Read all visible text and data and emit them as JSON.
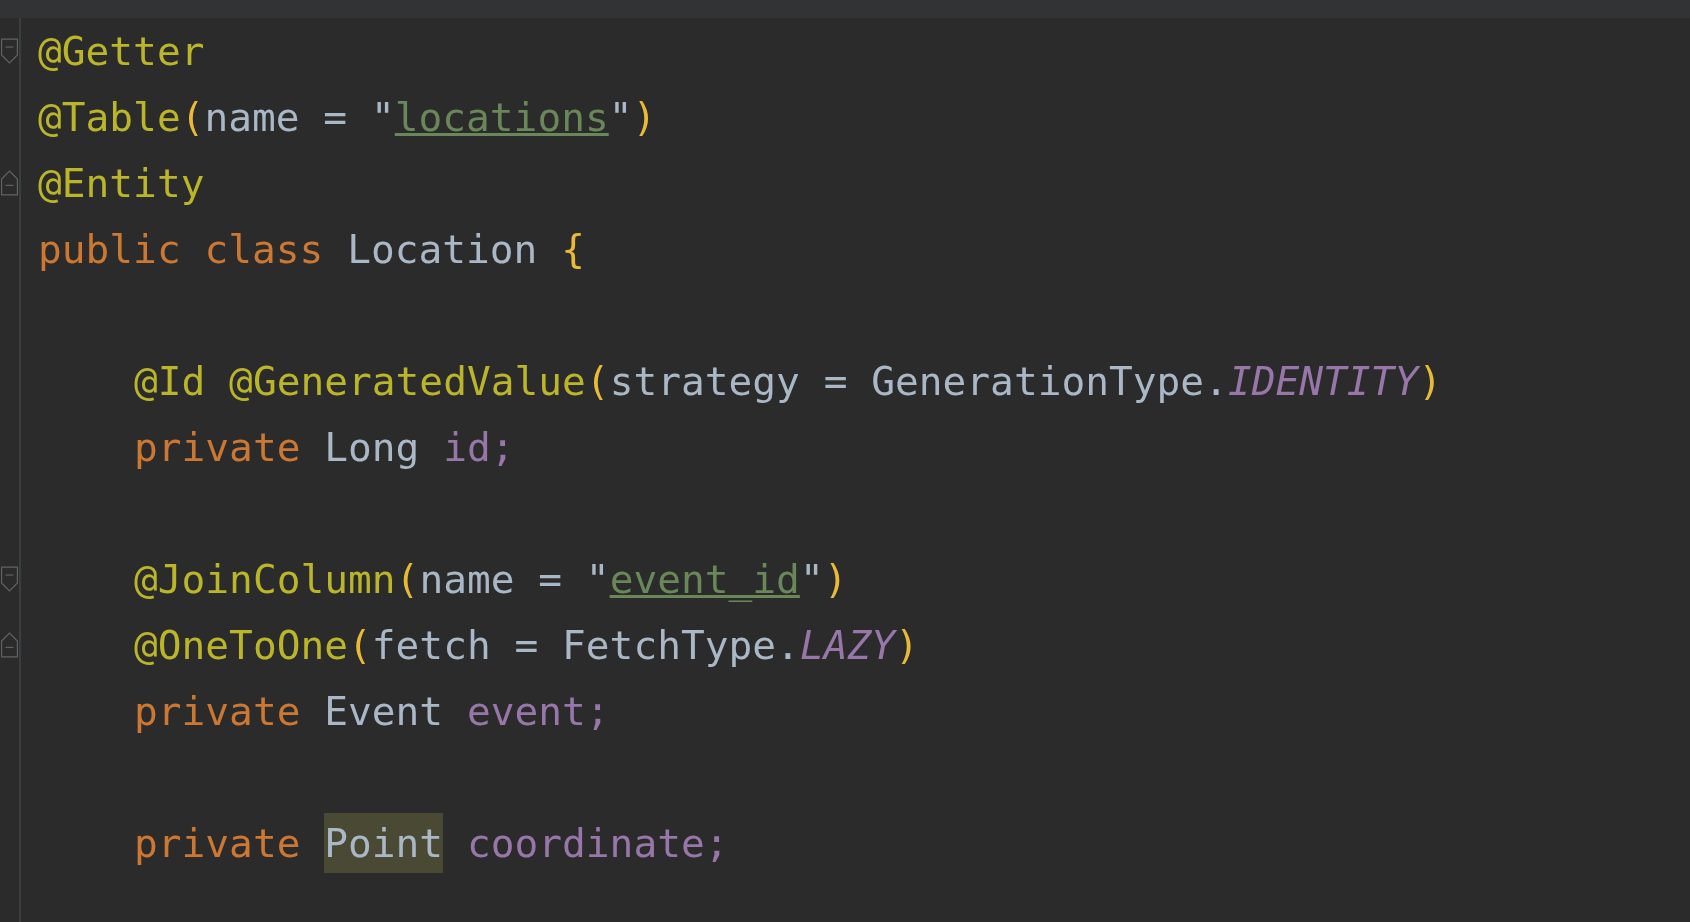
{
  "editor": {
    "lines": [
      {
        "kind": "code",
        "fold_start": true,
        "fold_end": false,
        "indented": false,
        "tokens": [
          {
            "text": "@Getter",
            "kind": "annotation"
          }
        ]
      },
      {
        "kind": "code",
        "fold_start": false,
        "fold_end": false,
        "indented": false,
        "tokens": [
          {
            "text": "@Table",
            "kind": "annotation"
          },
          {
            "text": "(",
            "kind": "bracket"
          },
          {
            "text": "name = \"",
            "kind": "plain"
          },
          {
            "text": "locations",
            "kind": "link"
          },
          {
            "text": "\"",
            "kind": "plain"
          },
          {
            "text": ")",
            "kind": "bracket"
          }
        ]
      },
      {
        "kind": "code",
        "fold_start": false,
        "fold_end": true,
        "indented": false,
        "tokens": [
          {
            "text": "@Entity",
            "kind": "annotation"
          }
        ]
      },
      {
        "kind": "code",
        "fold_start": false,
        "fold_end": false,
        "indented": false,
        "tokens": [
          {
            "text": "public class ",
            "kind": "keyword"
          },
          {
            "text": "Location ",
            "kind": "plain"
          },
          {
            "text": "{",
            "kind": "bracket"
          }
        ]
      },
      {
        "kind": "blank"
      },
      {
        "kind": "code",
        "fold_start": false,
        "fold_end": false,
        "indented": true,
        "tokens": [
          {
            "text": "@Id @GeneratedValue",
            "kind": "annotation"
          },
          {
            "text": "(",
            "kind": "bracket"
          },
          {
            "text": "strategy = GenerationType.",
            "kind": "plain"
          },
          {
            "text": "IDENTITY",
            "kind": "constant"
          },
          {
            "text": ")",
            "kind": "bracket"
          }
        ]
      },
      {
        "kind": "code",
        "fold_start": false,
        "fold_end": false,
        "indented": true,
        "tokens": [
          {
            "text": "private ",
            "kind": "keyword"
          },
          {
            "text": "Long ",
            "kind": "plain"
          },
          {
            "text": "id;",
            "kind": "field"
          }
        ]
      },
      {
        "kind": "blank"
      },
      {
        "kind": "code",
        "fold_start": true,
        "fold_end": false,
        "indented": true,
        "tokens": [
          {
            "text": "@JoinColumn",
            "kind": "annotation"
          },
          {
            "text": "(",
            "kind": "bracket"
          },
          {
            "text": "name = \"",
            "kind": "plain"
          },
          {
            "text": "event_id",
            "kind": "link"
          },
          {
            "text": "\"",
            "kind": "plain"
          },
          {
            "text": ")",
            "kind": "bracket"
          }
        ]
      },
      {
        "kind": "code",
        "fold_start": false,
        "fold_end": true,
        "indented": true,
        "tokens": [
          {
            "text": "@OneToOne",
            "kind": "annotation"
          },
          {
            "text": "(",
            "kind": "bracket"
          },
          {
            "text": "fetch = FetchType.",
            "kind": "plain"
          },
          {
            "text": "LAZY",
            "kind": "constant"
          },
          {
            "text": ")",
            "kind": "bracket"
          }
        ]
      },
      {
        "kind": "code",
        "fold_start": false,
        "fold_end": false,
        "indented": true,
        "tokens": [
          {
            "text": "private ",
            "kind": "keyword"
          },
          {
            "text": "Event ",
            "kind": "plain"
          },
          {
            "text": "event;",
            "kind": "field"
          }
        ]
      },
      {
        "kind": "blank"
      },
      {
        "kind": "code",
        "fold_start": false,
        "fold_end": false,
        "indented": true,
        "tokens": [
          {
            "text": "private ",
            "kind": "keyword"
          },
          {
            "text": "Point",
            "kind": "plain",
            "highlighted": true
          },
          {
            "text": " coordinate;",
            "kind": "field"
          }
        ]
      }
    ]
  }
}
